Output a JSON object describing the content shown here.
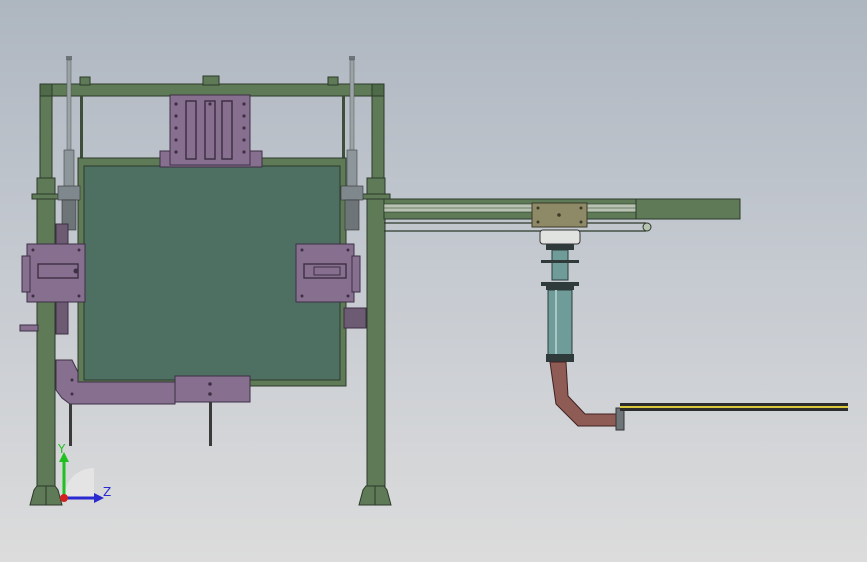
{
  "viewport": {
    "background_top": "#aeb6c0",
    "background_bottom": "#dcdcdc"
  },
  "colors": {
    "frame_green": "#5e7a56",
    "frame_edge": "#2c3a2a",
    "panel_teal": "#4d7063",
    "bracket_purple": "#87708f",
    "pipe_brown": "#8f5b55",
    "column_teal": "#6f9b98",
    "rod_gray": "#9aa3a6",
    "rail_yellow": "#d9c73c",
    "block_khaki": "#8e8a68"
  },
  "triad": {
    "y_label": "Y",
    "z_label": "Z",
    "y_color": "#21c021",
    "z_color": "#2a2ad0",
    "x_color": "#d02020"
  }
}
